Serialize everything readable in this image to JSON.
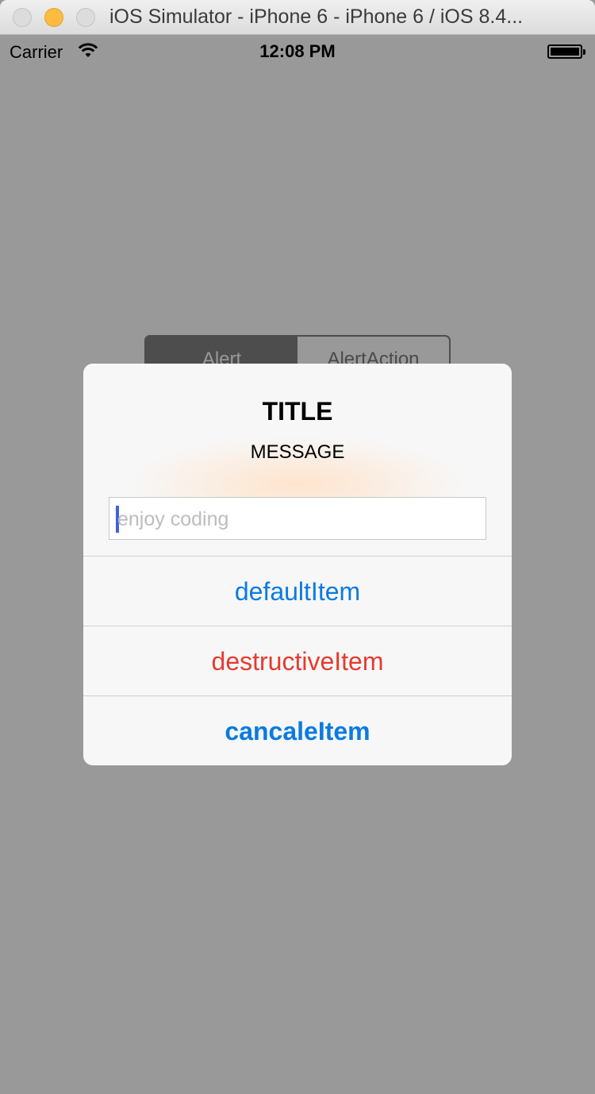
{
  "window": {
    "title": "iOS Simulator - iPhone 6 - iPhone 6 / iOS 8.4..."
  },
  "status_bar": {
    "carrier": "Carrier",
    "time": "12:08 PM",
    "icons": [
      "wifi-icon",
      "battery-icon"
    ]
  },
  "segmented_control": {
    "segments": [
      "Alert",
      "AlertAction"
    ],
    "selected": "Alert"
  },
  "alert": {
    "title": "TITLE",
    "message": "MESSAGE",
    "text_field": {
      "value": "",
      "placeholder": "enjoy coding"
    },
    "actions": {
      "default_label": "defaultItem",
      "destructive_label": "destructiveItem",
      "cancel_label": "cancaleItem"
    }
  },
  "colors": {
    "background": "#999999",
    "action_blue": "#0a7be0",
    "destructive_red": "#e63a2e"
  }
}
